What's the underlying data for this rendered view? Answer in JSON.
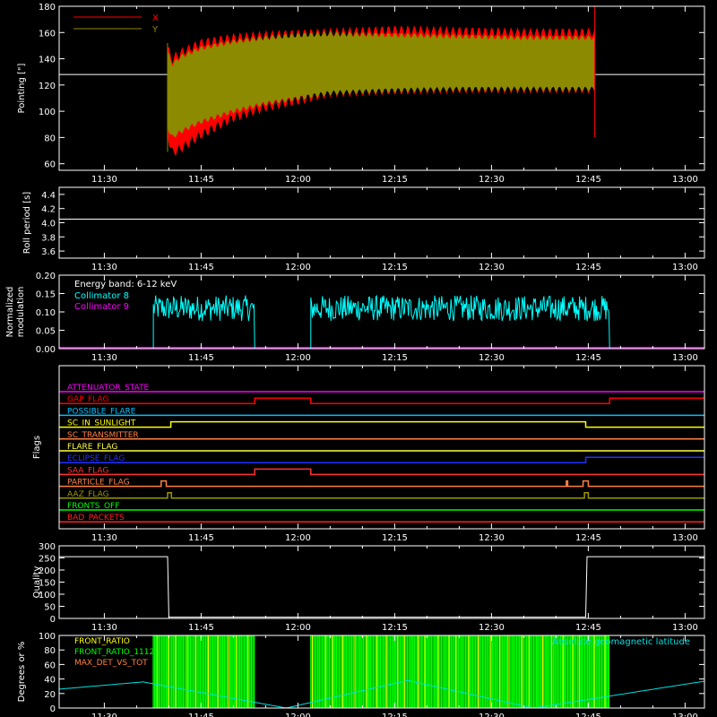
{
  "colors": {
    "background": "#000000",
    "axes": "#ffffff",
    "x_pointing": "#ff0000",
    "y_pointing": "#8c8a00",
    "reference": "#ffffff",
    "collimator8": "#00ffff",
    "collimator9": "#ff00ff",
    "front_ratio": "#ffff00",
    "front_ratio_1112": "#00ff00",
    "max_det_vs_tot": "#ff8040",
    "geomag": "#00e0e0"
  },
  "time_axis": {
    "tick_labels": [
      "11:30",
      "11:45",
      "12:00",
      "12:15",
      "12:30",
      "12:45",
      "13:00"
    ],
    "tick_minutes": [
      690,
      705,
      720,
      735,
      750,
      765,
      780
    ],
    "range_minutes": [
      683,
      783
    ]
  },
  "chart_data": [
    {
      "type": "area",
      "name": "pointing",
      "ylabel": "Pointing [\"]",
      "ylim": [
        55,
        180
      ],
      "y_ticks": [
        60,
        80,
        100,
        120,
        140,
        160,
        180
      ],
      "legend": [
        {
          "name": "X",
          "color": "#ff0000"
        },
        {
          "name": "Y",
          "color": "#8c8a00"
        }
      ],
      "legend_position": "top-left",
      "reference_value": 128,
      "data_window_minutes": [
        699.8,
        766.0
      ],
      "series": [
        {
          "name": "X",
          "x": [
            699.8,
            700.5,
            702,
            705,
            710,
            715,
            720,
            725,
            735,
            745,
            755,
            766
          ],
          "lower": [
            82,
            68,
            72,
            82,
            95,
            103,
            108,
            114,
            116,
            117,
            117,
            117
          ],
          "upper": [
            148,
            140,
            145,
            152,
            156,
            158,
            159,
            160,
            162,
            161,
            160,
            160
          ]
        },
        {
          "name": "Y",
          "x": [
            699.8,
            700.5,
            702,
            705,
            710,
            715,
            720,
            725,
            735,
            745,
            755,
            766
          ],
          "lower": [
            88,
            80,
            85,
            92,
            100,
            106,
            110,
            114,
            116,
            117,
            117,
            117
          ],
          "upper": [
            145,
            136,
            142,
            148,
            153,
            156,
            158,
            159,
            158,
            157,
            156,
            156
          ]
        }
      ]
    },
    {
      "type": "line",
      "name": "roll-period",
      "ylabel": "Roll period [s]",
      "ylim": [
        3.5,
        4.5
      ],
      "y_ticks": [
        3.6,
        3.8,
        4.0,
        4.2,
        4.4
      ],
      "series": [
        {
          "name": "",
          "x": [
            683,
            783
          ],
          "values": [
            4.05,
            4.05
          ]
        }
      ]
    },
    {
      "type": "line",
      "name": "modulation",
      "ylabel": "Normalized modulation",
      "ylim": [
        0,
        0.2
      ],
      "y_ticks": [
        0.0,
        0.05,
        0.1,
        0.15,
        0.2
      ],
      "annotation": "Energy band: 6-12 keV",
      "legend": [
        {
          "name": "Collimator 8",
          "color": "#00ffff"
        },
        {
          "name": "Collimator 9",
          "color": "#ff00ff"
        }
      ],
      "segments": [
        {
          "start": 697.6,
          "end": 713.3
        },
        {
          "start": 722.0,
          "end": 768.3
        }
      ],
      "mean": 0.11,
      "spread": 0.035
    },
    {
      "type": "line",
      "name": "flags",
      "ylabel": "Flags",
      "flags": [
        {
          "label": "ATTENUATOR_STATE",
          "color": "#ff00ff",
          "changes": []
        },
        {
          "label": "GAP_FLAG",
          "color": "#ff0000",
          "changes": [
            [
              713.3,
              1
            ],
            [
              722.0,
              0
            ],
            [
              768.3,
              1
            ]
          ]
        },
        {
          "label": "POSSIBLE_FLARE",
          "color": "#00bfff",
          "changes": []
        },
        {
          "label": "SC_IN_SUNLIGHT",
          "color": "#ffff00",
          "changes": [
            [
              700.3,
              1
            ],
            [
              764.6,
              0
            ]
          ]
        },
        {
          "label": "SC_TRANSMITTER",
          "color": "#ff8040",
          "changes": []
        },
        {
          "label": "FLARE_FLAG",
          "color": "#ffff40",
          "changes": []
        },
        {
          "label": "ECLIPSE_FLAG",
          "color": "#2030ff",
          "changes": [
            [
              700.3,
              0
            ],
            [
              764.6,
              1
            ]
          ]
        },
        {
          "label": "SAA_FLAG",
          "color": "#ff3030",
          "changes": [
            [
              713.3,
              1
            ],
            [
              722.0,
              0
            ]
          ]
        },
        {
          "label": "PARTICLE_FLAG",
          "color": "#ff8040",
          "changes": [
            [
              698.8,
              1
            ],
            [
              699.6,
              0
            ],
            [
              761.6,
              1
            ],
            [
              761.8,
              0
            ],
            [
              764.2,
              1
            ],
            [
              765.0,
              0
            ]
          ]
        },
        {
          "label": "AAZ_FLAG",
          "color": "#9a9600",
          "changes": [
            [
              699.8,
              1
            ],
            [
              700.4,
              0
            ],
            [
              764.4,
              1
            ],
            [
              765.0,
              0
            ]
          ]
        },
        {
          "label": "FRONTS_OFF",
          "color": "#00ff00",
          "changes": []
        },
        {
          "label": "BAD_PACKETS",
          "color": "#ff2020",
          "changes": []
        }
      ]
    },
    {
      "type": "line",
      "name": "quality",
      "ylabel": "Quality",
      "ylim": [
        0,
        300
      ],
      "y_ticks": [
        0,
        50,
        100,
        150,
        200,
        250,
        300
      ],
      "series": [
        {
          "name": "Quality",
          "x": [
            683,
            699.8,
            700.0,
            764.6,
            764.8,
            783
          ],
          "values": [
            255,
            255,
            5,
            5,
            255,
            255
          ]
        }
      ]
    },
    {
      "type": "line",
      "name": "front-ratio",
      "ylabel": "Degrees or %",
      "ylim": [
        0,
        100
      ],
      "y_ticks": [
        0,
        20,
        40,
        60,
        80,
        100
      ],
      "legend": [
        {
          "name": "FRONT_RATIO",
          "color": "#ffff00"
        },
        {
          "name": "FRONT_RATIO_1112",
          "color": "#00ff00"
        },
        {
          "name": "MAX_DET_VS_TOT",
          "color": "#ff8040"
        }
      ],
      "annotation": "Absolute geomagnetic latitude",
      "segments": [
        {
          "start": 697.6,
          "end": 713.3
        },
        {
          "start": 722.0,
          "end": 768.3
        }
      ],
      "geomag": {
        "x": [
          683,
          696,
          718.2,
          737,
          756.5,
          783
        ],
        "values": [
          26,
          36,
          0,
          38,
          0,
          37
        ]
      }
    }
  ]
}
